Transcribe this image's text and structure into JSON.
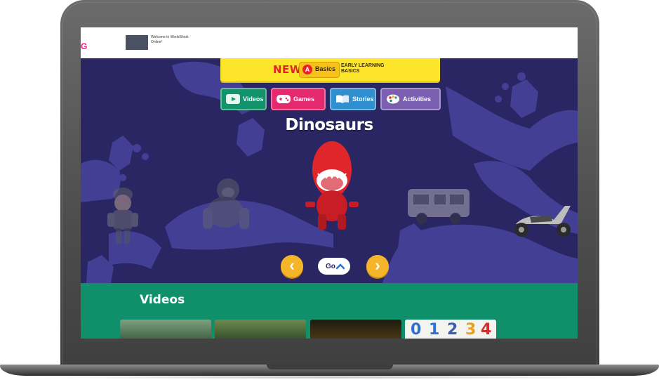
{
  "header": {
    "logo_fragment": "G",
    "welcome_text": "Welcome to World Book Online!"
  },
  "banner": {
    "new_label": "NEW",
    "product_label": "Basics",
    "product_icon_letter": "A",
    "description": "EARLY LEARNING BASICS"
  },
  "tabs": [
    {
      "label": "Videos",
      "color": "#13936b",
      "icon": "video-icon"
    },
    {
      "label": "Games",
      "color": "#e5296e",
      "icon": "gamepad-icon"
    },
    {
      "label": "Stories",
      "color": "#2f8fcf",
      "icon": "book-icon"
    },
    {
      "label": "Activities",
      "color": "#7b5fb0",
      "icon": "palette-icon"
    }
  ],
  "hero": {
    "title": "Dinosaurs",
    "background_color": "#2a2663",
    "characters": [
      "hiker-kid",
      "gorilla",
      "red-t-rex",
      "camper-van",
      "scooter"
    ]
  },
  "controls": {
    "prev_icon": "chevron-left-icon",
    "next_icon": "chevron-right-icon",
    "go_label": "Go"
  },
  "videos": {
    "title": "Videos",
    "thumbnails": [
      "video-thumb-1",
      "video-thumb-2",
      "video-thumb-3",
      "video-thumb-4"
    ],
    "thumb4_digits": [
      "0",
      "1",
      "2",
      "3",
      "4"
    ]
  }
}
